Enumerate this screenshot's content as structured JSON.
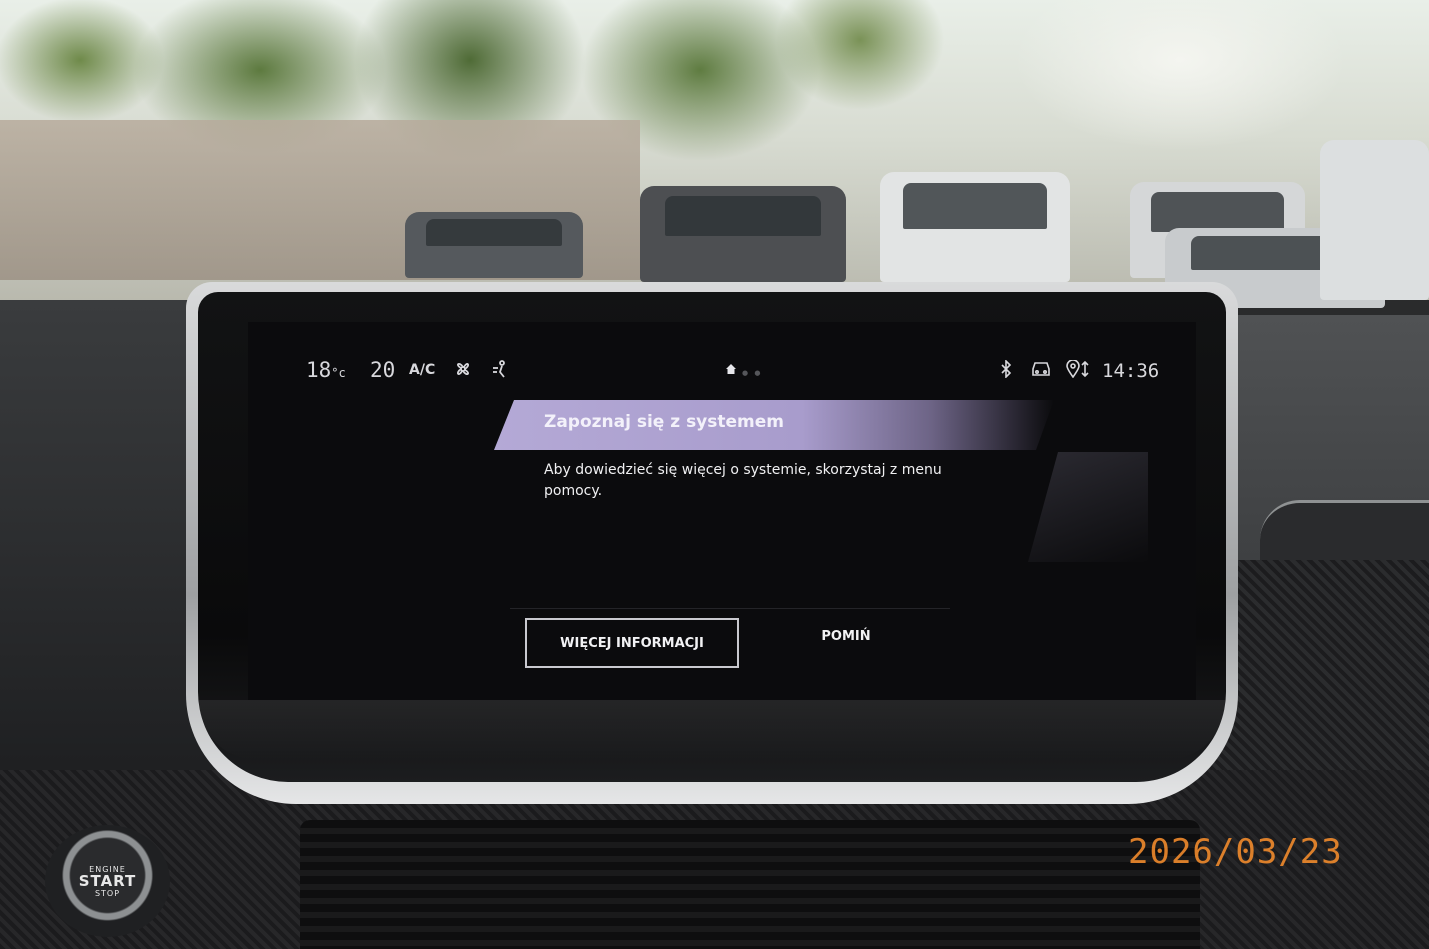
{
  "status_bar": {
    "temp_left": "18",
    "temp_left_unit": "°c",
    "temp_right": "20",
    "ac_label": "A/C",
    "fan_icon": "fan-icon",
    "airflow_icon": "airflow-icon",
    "home_icon": "home-icon",
    "bluetooth_icon": "bluetooth-icon",
    "car_icon": "car-icon",
    "gps_icon": "gps-icon",
    "clock": "14:36"
  },
  "dialog": {
    "title": "Zapoznaj się z systemem",
    "body": "Aby dowiedzieć się więcej o systemie, skorzystaj z menu pomocy.",
    "primary_button": "WIĘCEJ INFORMACJI",
    "secondary_button": "POMIŃ"
  },
  "photo": {
    "start_button": {
      "line1": "ENGINE",
      "line2": "START",
      "line3": "STOP"
    },
    "date_stamp": "2026/03/23"
  },
  "colors": {
    "banner": "#b4a9d6",
    "screen_bg": "#0b0b0d",
    "text": "#f0f0f2",
    "date_stamp": "#f08a2c"
  }
}
